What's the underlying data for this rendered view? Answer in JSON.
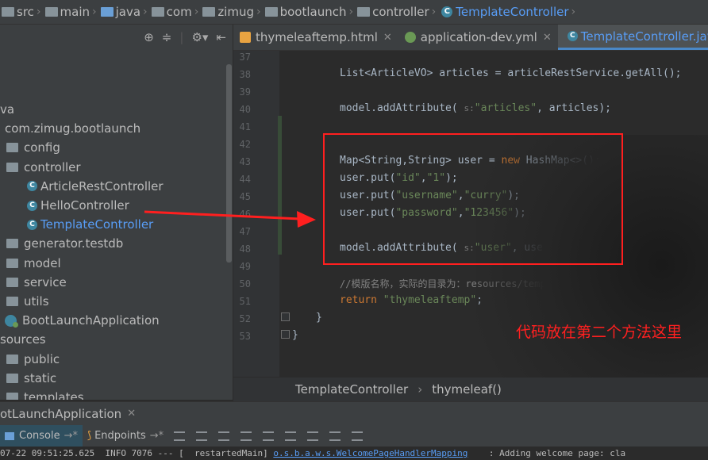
{
  "navbar": {
    "crumbs": [
      "src",
      "main",
      "java",
      "com",
      "zimug",
      "bootlaunch",
      "controller",
      "TemplateController"
    ]
  },
  "project_tree": {
    "items": [
      {
        "label": "va",
        "indent": 0
      },
      {
        "label": "com.zimug.bootlaunch",
        "indent": 0
      },
      {
        "label": "config",
        "indent": 1
      },
      {
        "label": "controller",
        "indent": 1
      },
      {
        "label": "ArticleRestController",
        "indent": 2
      },
      {
        "label": "HelloController",
        "indent": 2
      },
      {
        "label": "TemplateController",
        "indent": 2
      },
      {
        "label": "generator.testdb",
        "indent": 1
      },
      {
        "label": "model",
        "indent": 1
      },
      {
        "label": "service",
        "indent": 1
      },
      {
        "label": "utils",
        "indent": 1
      },
      {
        "label": "BootLaunchApplication",
        "indent": 1
      },
      {
        "label": "sources",
        "indent": 0
      },
      {
        "label": "public",
        "indent": 0
      },
      {
        "label": "static",
        "indent": 0
      },
      {
        "label": "templates",
        "indent": 0
      }
    ]
  },
  "tabs": [
    {
      "label": "thymeleaftemp.html",
      "active": false
    },
    {
      "label": "application-dev.yml",
      "active": false
    },
    {
      "label": "TemplateController.java",
      "active": true
    }
  ],
  "editor": {
    "line_numbers": [
      "37",
      "38",
      "39",
      "40",
      "41",
      "42",
      "43",
      "44",
      "45",
      "46",
      "47",
      "48",
      "49",
      "50",
      "51",
      "52",
      "53"
    ],
    "code": {
      "l38": "List<ArticleVO> articles = articleRestService.getAll();",
      "l40a": "model.addAttribute(",
      "l40hint": "s:",
      "l40str": "\"articles\"",
      "l40b": ", articles);",
      "l43a": "Map<String,String> user = ",
      "l43kw": "new",
      "l43b": " HashMap<>();",
      "l44a": "user.put(",
      "l44s1": "\"id\"",
      "l44c": ",",
      "l44s2": "\"1\"",
      "l44b": ");",
      "l45a": "user.put(",
      "l45s1": "\"username\"",
      "l45c": ",",
      "l45s2": "\"curry\"",
      "l45b": ");",
      "l46a": "user.put(",
      "l46s1": "\"password\"",
      "l46c": ",",
      "l46s2": "\"123456\"",
      "l46b": ");",
      "l48a": "model.addAttribute(",
      "l48hint": "s:",
      "l48str": "\"user\"",
      "l48b": ", user);",
      "l50": "//模版名称，实际的目录为：resources/templates/thymeleaftemp.html",
      "l51kw": "return",
      "l51str": " \"thymeleaftemp\"",
      "l51b": ";",
      "l52": "}",
      "l53": "}"
    }
  },
  "annotation": "代码放在第二个方法这里",
  "editor_breadcrumb": [
    "TemplateController",
    "thymeleaf()"
  ],
  "run_panel": {
    "title": "otLaunchApplication",
    "tabs": [
      "Console",
      "Endpoints"
    ],
    "log_parts": {
      "time": "07-22 09:51:25.625  INFO 7076 --- [  restartedMain] ",
      "logger": "o.s.b.a.w.s.WelcomePageHandlerMapping",
      "msg": "    : Adding welcome page: cla"
    }
  },
  "colors": {
    "accent": "#589df6",
    "annotation_red": "#ff1f1f"
  }
}
